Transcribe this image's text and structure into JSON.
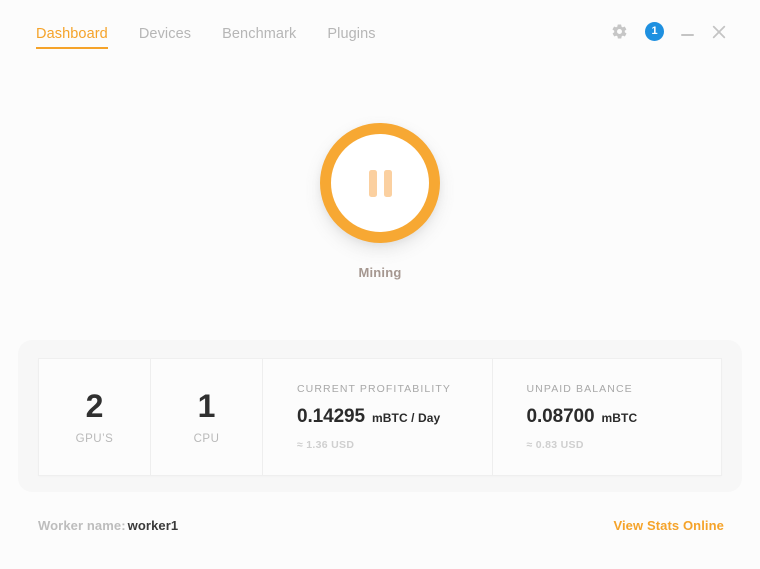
{
  "header": {
    "tabs": [
      {
        "label": "Dashboard",
        "active": true
      },
      {
        "label": "Devices",
        "active": false
      },
      {
        "label": "Benchmark",
        "active": false
      },
      {
        "label": "Plugins",
        "active": false
      }
    ],
    "settings_icon": "gear-icon",
    "notification_count": "1",
    "notification_color": "#1e90e0",
    "minimize_label": "—",
    "close_label": "✕"
  },
  "mining": {
    "state_icon": "pause-icon",
    "status_label": "Mining",
    "accent_color": "#f7a833",
    "icon_color": "#fbd0a0"
  },
  "stats": {
    "gpu": {
      "value": "2",
      "label": "GPU’S"
    },
    "cpu": {
      "value": "1",
      "label": "CPU"
    },
    "profitability": {
      "label": "CURRENT PROFITABILITY",
      "value": "0.14295",
      "unit": "mBTC / Day",
      "usd": "≈ 1.36 USD"
    },
    "balance": {
      "label": "UNPAID BALANCE",
      "value": "0.08700",
      "unit": "mBTC",
      "usd": "≈ 0.83 USD"
    }
  },
  "footer": {
    "worker_label": "Worker name:",
    "worker_name": "worker1",
    "stats_link": "View Stats Online",
    "link_color": "#f5a32a"
  }
}
